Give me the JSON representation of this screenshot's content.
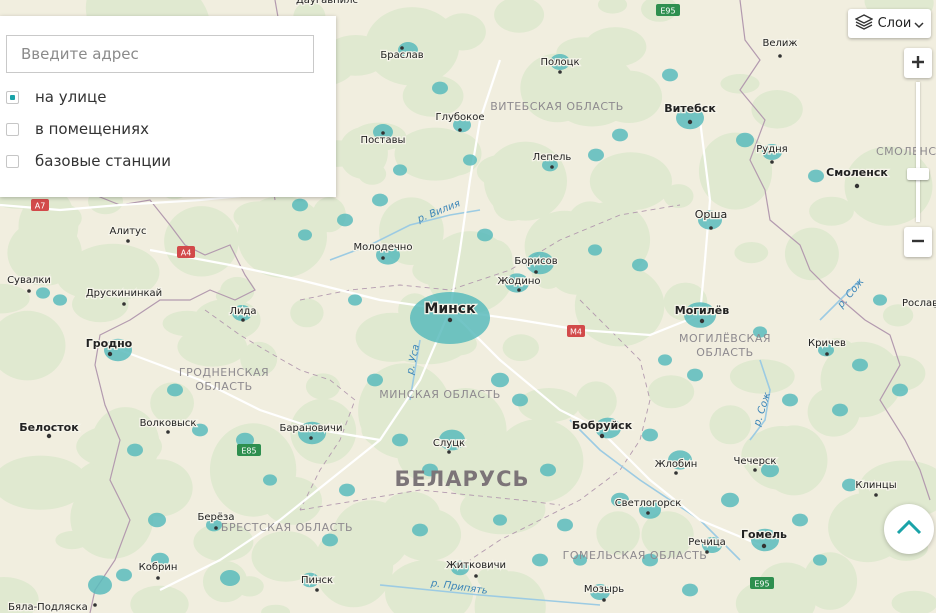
{
  "search": {
    "placeholder": "Введите адрес",
    "value": ""
  },
  "filters": [
    {
      "label": "на улице",
      "checked": true
    },
    {
      "label": "в помещениях",
      "checked": false
    },
    {
      "label": "базовые станции",
      "checked": false
    }
  ],
  "layers_button": {
    "label": "Слои",
    "icon": "layers-icon"
  },
  "zoom": {
    "in_icon": "plus-icon",
    "out_icon": "minus-icon"
  },
  "scroll_top": {
    "icon": "chevron-up-icon"
  },
  "colors": {
    "land": "#f1eedf",
    "forest": "#dfe9cf",
    "coverage": "#5bbcbd",
    "accent": "#1aa3a8",
    "border": "#b39aaf",
    "river": "#9ccbe3",
    "road": "#ffffff"
  },
  "map": {
    "country": "БЕЛАРУСЬ",
    "regions": [
      "ВИТЕБСКАЯ ОБЛАСТЬ",
      "ГРОДНЕНСКАЯ ОБЛАСТЬ",
      "МИНСКАЯ ОБЛАСТЬ",
      "МОГИЛЁВСКАЯ ОБЛАСТЬ",
      "БРЕСТСКАЯ ОБЛАСТЬ",
      "ГОМЕЛЬСКАЯ ОБЛАСТЬ",
      "СМОЛЕНСК"
    ],
    "cities": [
      "Браслав",
      "Полоцк",
      "Витебск",
      "Велиж",
      "Глубокое",
      "Поставы",
      "Лепель",
      "Рудня",
      "Смоленск",
      "Орша",
      "Молодечно",
      "Борисов",
      "Жодино",
      "Минск",
      "Могилёв",
      "Кричев",
      "Рослав",
      "Алитус",
      "Сувалки",
      "Друскининкай",
      "Лида",
      "Гродно",
      "Белосток",
      "Волковыск",
      "Барановичи",
      "Слуцк",
      "Бобруйск",
      "Жлобин",
      "Чечерск",
      "Клинцы",
      "Светлогорск",
      "Берёза",
      "Речица",
      "Гомель",
      "Кобрин",
      "Пинск",
      "Житковичи",
      "Мозырь",
      "Бяла-Подляска",
      "Даугавпилс"
    ],
    "rivers": [
      "р. Вилия",
      "р. Уса",
      "р. Сож",
      "р. Сож",
      "р. Припять"
    ],
    "roads": [
      "E95",
      "A7",
      "A4",
      "M4",
      "E85",
      "E95"
    ]
  }
}
